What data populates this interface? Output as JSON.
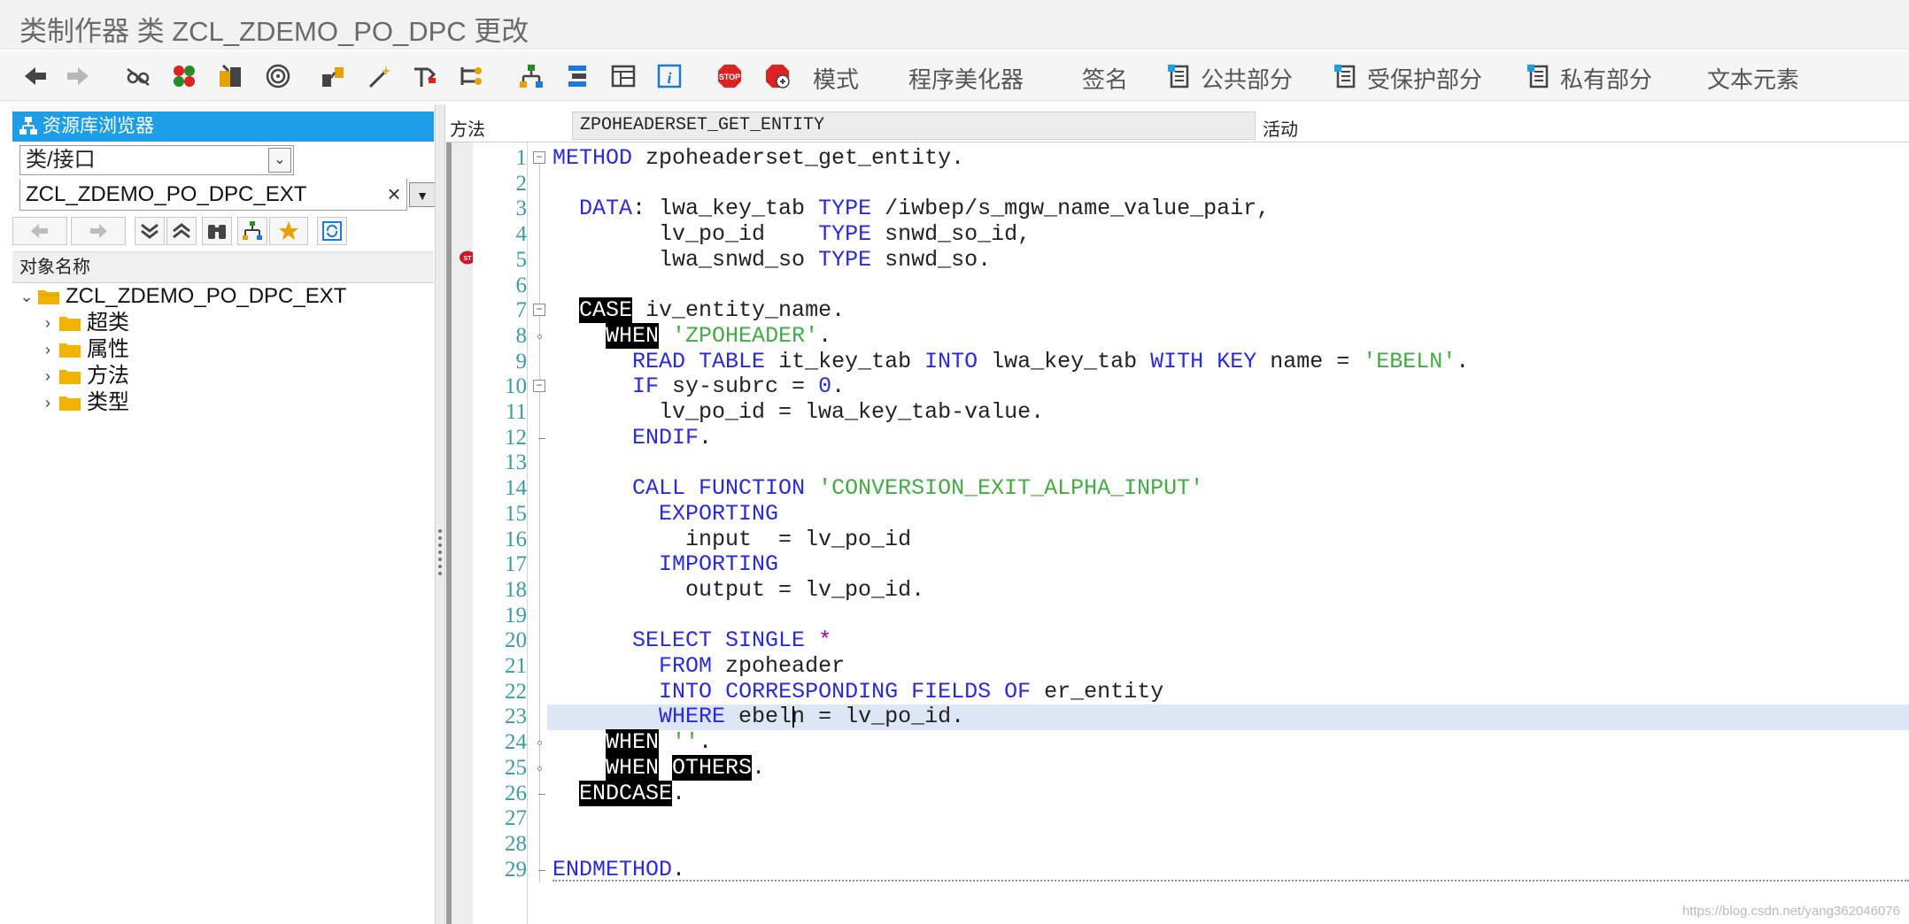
{
  "window": {
    "title": "类制作器 类 ZCL_ZDEMO_PO_DPC 更改"
  },
  "toolbar": {
    "mode_label": "模式",
    "pretty_printer_label": "程序美化器",
    "signature_label": "签名",
    "public_section_label": "公共部分",
    "protected_section_label": "受保护部分",
    "private_section_label": "私有部分",
    "text_elements_label": "文本元素"
  },
  "repository_browser": {
    "header": "资源库浏览器",
    "object_type": "类/接口",
    "object_name_value": "ZCL_ZDEMO_PO_DPC_EXT",
    "clear_glyph": "×",
    "tree_header": "对象名称",
    "tree": {
      "root": "ZCL_ZDEMO_PO_DPC_EXT",
      "children": [
        "超类",
        "属性",
        "方法",
        "类型"
      ]
    }
  },
  "method_bar": {
    "label": "方法",
    "value": "ZPOHEADERSET_GET_ENTITY",
    "status": "活动"
  },
  "editor": {
    "line_numbers": [
      "1",
      "2",
      "3",
      "4",
      "5",
      "6",
      "7",
      "8",
      "9",
      "10",
      "11",
      "12",
      "13",
      "14",
      "15",
      "16",
      "17",
      "18",
      "19",
      "20",
      "21",
      "22",
      "23",
      "24",
      "25",
      "26",
      "27",
      "28",
      "29"
    ],
    "current_line": "23",
    "lines": [
      "METHOD zpoheaderset_get_entity.",
      "",
      "  DATA: lwa_key_tab TYPE /iwbep/s_mgw_name_value_pair,",
      "        lv_po_id    TYPE snwd_so_id,",
      "        lwa_snwd_so TYPE snwd_so.",
      "",
      "  CASE iv_entity_name.",
      "    WHEN 'ZPOHEADER'.",
      "      READ TABLE it_key_tab INTO lwa_key_tab WITH KEY name = 'EBELN'.",
      "      IF sy-subrc = 0.",
      "        lv_po_id = lwa_key_tab-value.",
      "      ENDIF.",
      "",
      "      CALL FUNCTION 'CONVERSION_EXIT_ALPHA_INPUT'",
      "        EXPORTING",
      "          input  = lv_po_id",
      "        IMPORTING",
      "          output = lv_po_id.",
      "",
      "      SELECT SINGLE *",
      "        FROM zpoheader",
      "        INTO CORRESPONDING FIELDS OF er_entity",
      "        WHERE ebeln = lv_po_id.",
      "    WHEN ''.",
      "    WHEN OTHERS.",
      "  ENDCASE.",
      "",
      "",
      "ENDMETHOD."
    ]
  },
  "watermark": "https://blog.csdn.net/yang362046076",
  "colors": {
    "keyword": "#2a2add",
    "string": "#44aa44",
    "line_number": "#3c9c9c",
    "header_blue": "#1e9ee6",
    "current_line": "#dce6f4"
  }
}
